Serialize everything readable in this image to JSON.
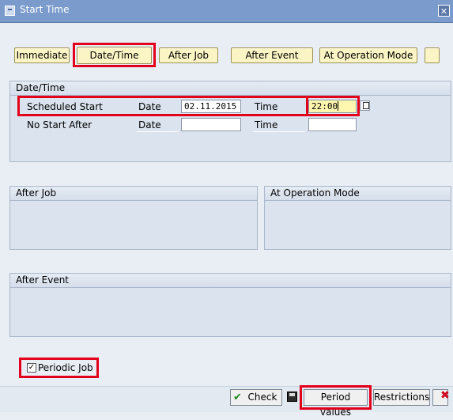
{
  "window": {
    "title": "Start Time"
  },
  "toolbar": {
    "immediate": "Immediate",
    "datetime": "Date/Time",
    "after_job": "After Job",
    "after_event": "After Event",
    "at_operation_mode": "At Operation Mode"
  },
  "datetime_group": {
    "title": "Date/Time",
    "scheduled_start": {
      "label": "Scheduled Start",
      "date_label": "Date",
      "date_value": "02.11.2015",
      "time_label": "Time",
      "time_value": "22:00"
    },
    "no_start_after": {
      "label": "No Start After",
      "date_label": "Date",
      "date_value": "",
      "time_label": "Time",
      "time_value": ""
    }
  },
  "after_job_group": {
    "title": "After Job"
  },
  "operation_mode_group": {
    "title": "At Operation Mode"
  },
  "after_event_group": {
    "title": "After Event"
  },
  "periodic_job": {
    "label": "Periodic Job",
    "checked": true,
    "check_glyph": "✓"
  },
  "footer": {
    "check": "Check",
    "period_values": "Period values",
    "restrictions": "Restrictions"
  },
  "colors": {
    "highlight": "#e2001a",
    "titlebar": "#7a9bcb",
    "button": "#fbf4c4"
  }
}
